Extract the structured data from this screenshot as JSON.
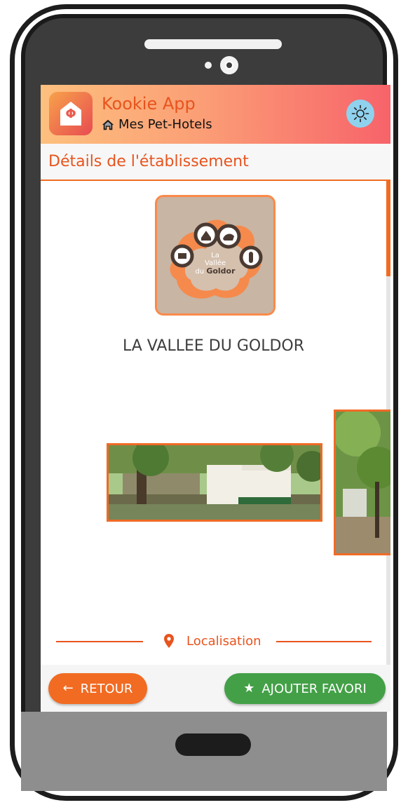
{
  "app": {
    "title": "Kookie App",
    "subtitle": "Mes Pet-Hotels",
    "logo_symbol": "Φ",
    "theme_toggle_icon": "sun-icon"
  },
  "page": {
    "title": "Détails de l'établissement"
  },
  "establishment": {
    "name": "LA VALLEE DU GOLDOR",
    "logo_text": [
      "La",
      "Vallée",
      "du",
      "Goldor"
    ],
    "photos": [
      "photo-kennel-panorama",
      "photo-garden-trees"
    ]
  },
  "localisation": {
    "label": "Localisation",
    "icon": "map-pin-icon"
  },
  "footer": {
    "back_label": "RETOUR",
    "back_icon": "←",
    "favorite_label": "AJOUTER FAVORI",
    "favorite_icon": "★"
  },
  "colors": {
    "accent": "#f26b22",
    "header_gradient": [
      "#fdc07e",
      "#f7636a"
    ],
    "favorite_green": "#43a047",
    "theme_button": "#8fd2ee"
  }
}
